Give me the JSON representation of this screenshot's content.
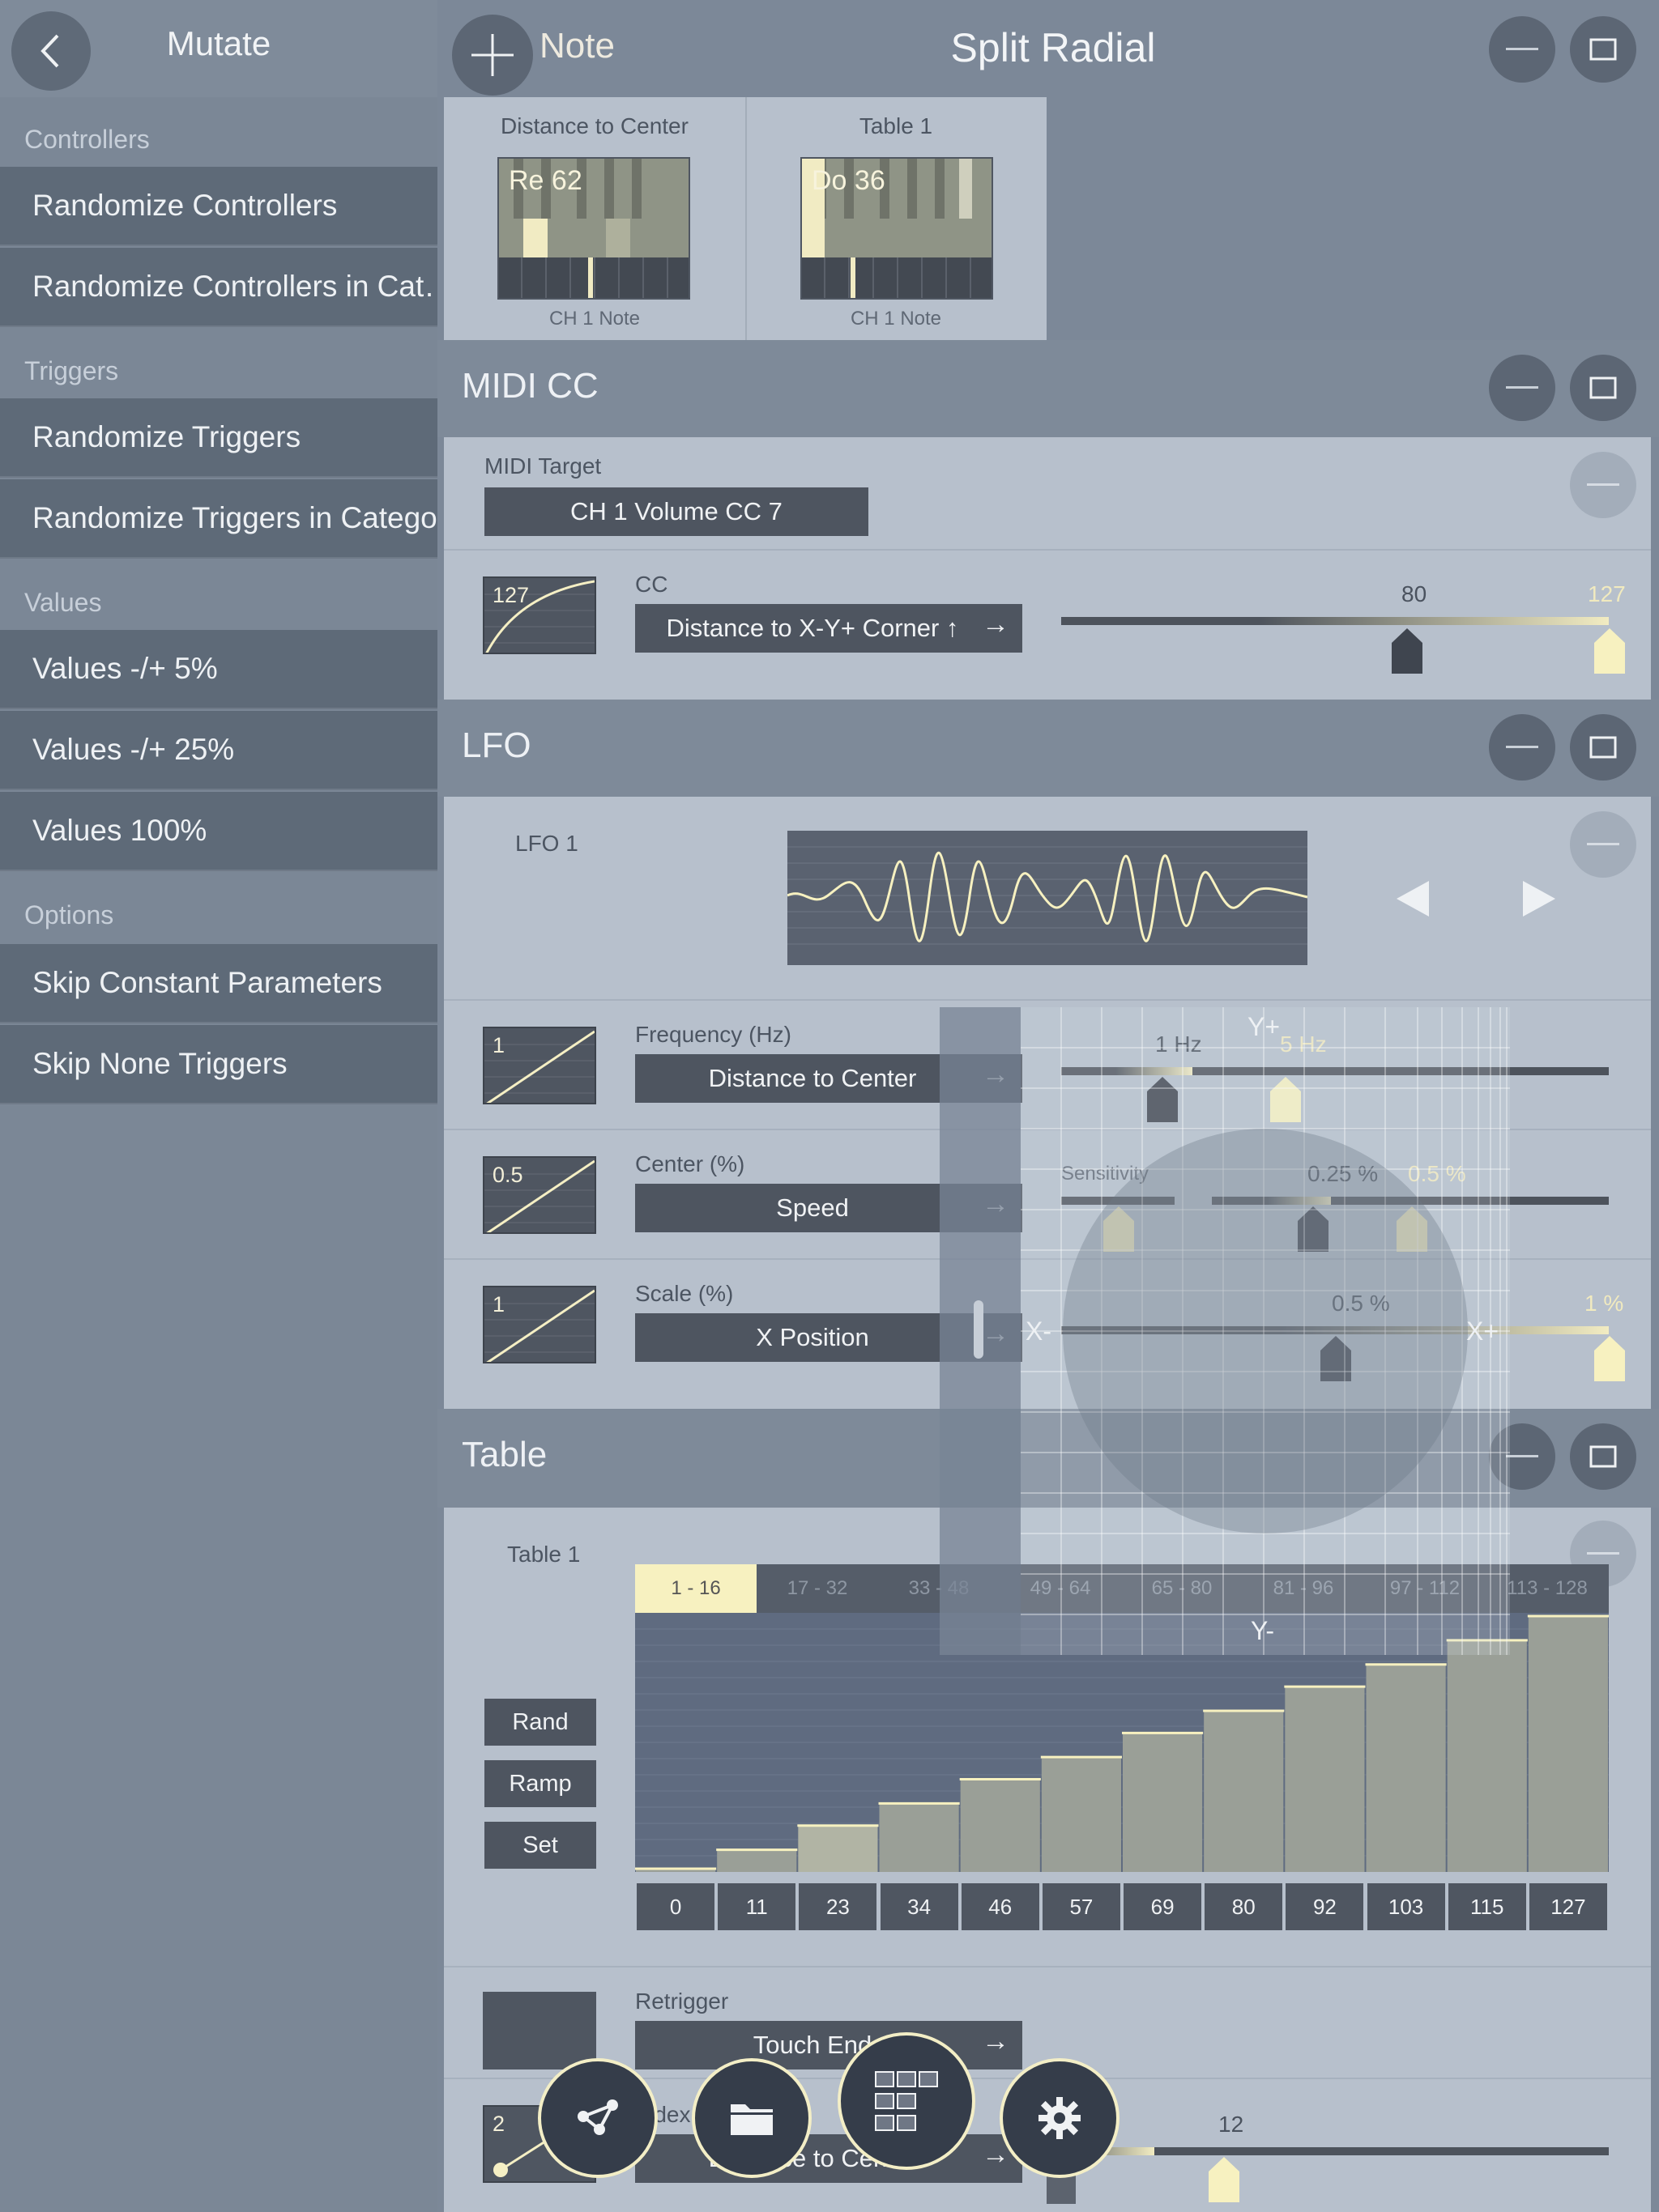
{
  "sidebar": {
    "title": "Mutate",
    "categories": [
      "Controllers",
      "Triggers",
      "Values",
      "Options"
    ],
    "items": [
      "Randomize Controllers",
      "Randomize Controllers in Cat…",
      "Randomize Triggers",
      "Randomize Triggers in Category",
      "Values -/+ 5%",
      "Values -/+ 25%",
      "Values 100%",
      "Skip Constant Parameters",
      "Skip None Triggers"
    ]
  },
  "header": {
    "note_label": "Note",
    "title": "Split Radial"
  },
  "note_cards": [
    {
      "title": "Distance to Center",
      "note": "Re 62",
      "channel": "CH 1 Note"
    },
    {
      "title": "Table 1",
      "note": "Do 36",
      "channel": "CH 1 Note"
    }
  ],
  "midi_cc": {
    "title": "MIDI CC",
    "target_label": "MIDI Target",
    "target_value": "CH 1 Volume CC 7",
    "cc_label": "CC",
    "curve_value": "127",
    "source": "Distance to X-Y+ Corner ↑",
    "min_value": "80",
    "max_value": "127"
  },
  "lfo": {
    "title": "LFO",
    "name": "LFO 1",
    "frequency": {
      "label": "Frequency (Hz)",
      "curve_value": "1",
      "source": "Distance to Center",
      "min": "1 Hz",
      "max": "5 Hz"
    },
    "center": {
      "label": "Center (%)",
      "curve_value": "0.5",
      "source": "Speed",
      "sensitivity_label": "Sensitivity",
      "min": "0.25 %",
      "max": "0.5 %"
    },
    "scale": {
      "label": "Scale (%)",
      "curve_value": "1",
      "source": "X Position",
      "min": "0.5 %",
      "max": "1 %"
    }
  },
  "overlay": {
    "y_plus": "Y+",
    "y_minus": "Y-",
    "x_minus": "X-",
    "x_plus": "X+"
  },
  "table": {
    "title": "Table",
    "name": "Table 1",
    "ranges": [
      "1 - 16",
      "17 - 32",
      "33 - 48",
      "49 - 64",
      "65 - 80",
      "81 - 96",
      "97 - 112",
      "113 - 128"
    ],
    "buttons": [
      "Rand",
      "Ramp",
      "Set"
    ],
    "values": [
      "0",
      "11",
      "23",
      "34",
      "46",
      "57",
      "69",
      "80",
      "92",
      "103",
      "115",
      "127"
    ]
  },
  "retrigger": {
    "label": "Retrigger",
    "value": "Touch End"
  },
  "index": {
    "label": "Index",
    "curve_value": "2",
    "source": "Distance to Center",
    "value": "12"
  },
  "colors": {
    "accent": "#f7f1c0",
    "dark": "#4e5560",
    "panel": "#b7c0cc"
  }
}
